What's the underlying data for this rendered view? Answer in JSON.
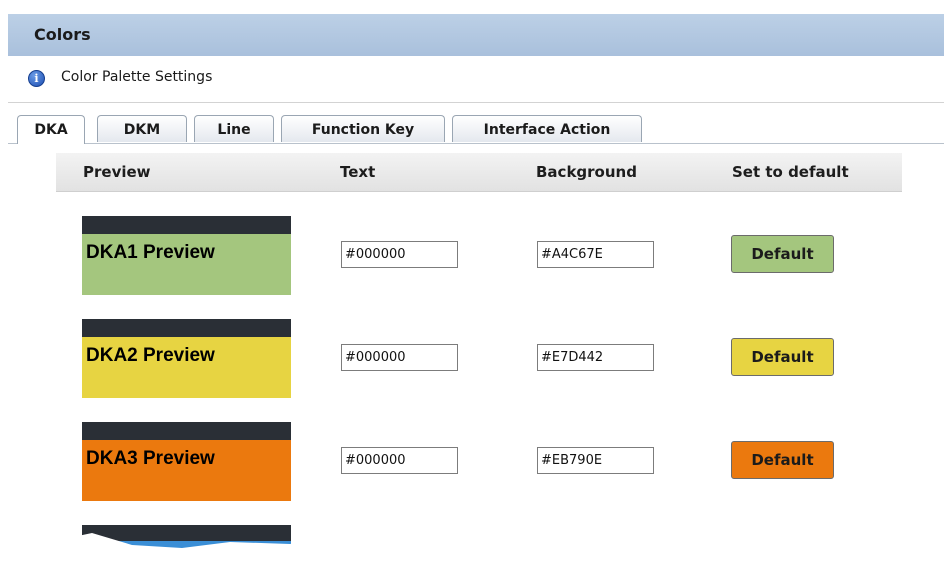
{
  "window": {
    "title": "Colors"
  },
  "info": {
    "subtitle": "Color Palette Settings",
    "icon": "info-icon"
  },
  "tabs": [
    {
      "label": "DKA",
      "active": true
    },
    {
      "label": "DKM",
      "active": false
    },
    {
      "label": "Line",
      "active": false
    },
    {
      "label": "Function Key",
      "active": false
    },
    {
      "label": "Interface Action",
      "active": false
    }
  ],
  "table": {
    "headers": {
      "preview": "Preview",
      "text": "Text",
      "background": "Background",
      "default": "Set to default"
    },
    "rows": [
      {
        "preview_label": "DKA1 Preview",
        "text_color": "#000000",
        "background_color": "#A4C67E",
        "button_label": "Default"
      },
      {
        "preview_label": "DKA2 Preview",
        "text_color": "#000000",
        "background_color": "#E7D442",
        "button_label": "Default"
      },
      {
        "preview_label": "DKA3 Preview",
        "text_color": "#000000",
        "background_color": "#EB790E",
        "button_label": "Default"
      }
    ]
  }
}
